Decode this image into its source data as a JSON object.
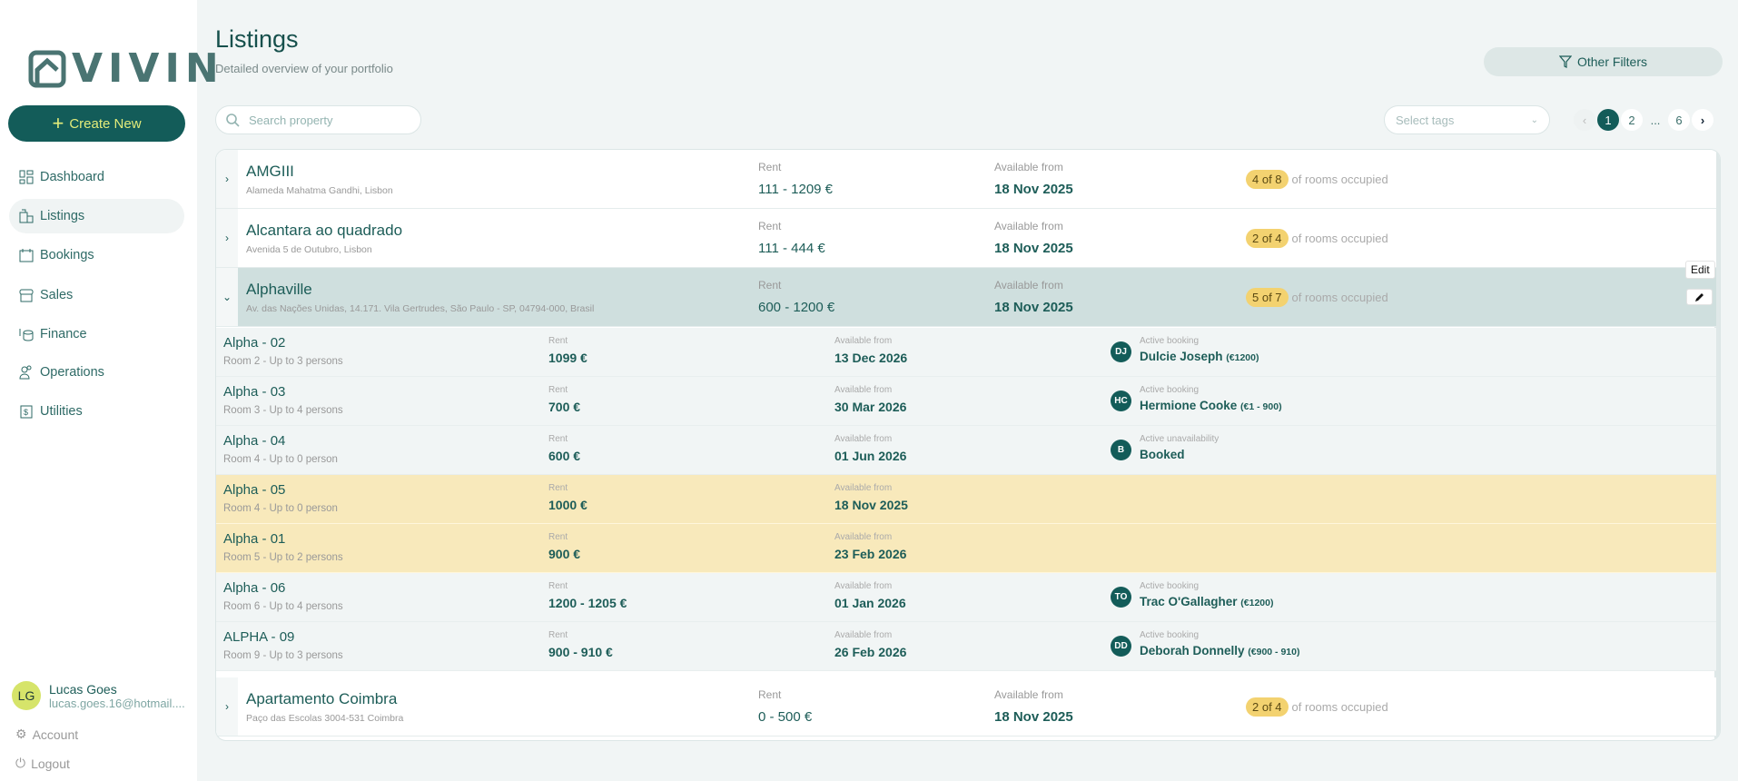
{
  "brand": {
    "name": "VIVIN"
  },
  "sidebar": {
    "create_label": "Create New",
    "items": [
      {
        "label": "Dashboard",
        "icon": "dashboard-icon"
      },
      {
        "label": "Listings",
        "icon": "building-icon",
        "active": true
      },
      {
        "label": "Bookings",
        "icon": "calendar-icon"
      },
      {
        "label": "Sales",
        "icon": "store-icon"
      },
      {
        "label": "Finance",
        "icon": "coins-icon"
      },
      {
        "label": "Operations",
        "icon": "users-icon"
      },
      {
        "label": "Utilities",
        "icon": "receipt-icon"
      }
    ],
    "user": {
      "initials": "LG",
      "name": "Lucas Goes",
      "email": "lucas.goes.16@hotmail...."
    },
    "account_label": "Account",
    "logout_label": "Logout"
  },
  "header": {
    "title": "Listings",
    "subtitle": "Detailed overview of your portfolio",
    "other_filters": "Other Filters"
  },
  "search": {
    "placeholder": "Search property",
    "value": ""
  },
  "tags": {
    "placeholder": "Select tags"
  },
  "pagination": {
    "pages": [
      "1",
      "2",
      "...",
      "6"
    ],
    "current": "1"
  },
  "labels": {
    "rent": "Rent",
    "available": "Available from",
    "occupied": "of rooms occupied",
    "edit": "Edit"
  },
  "properties": [
    {
      "name": "AMGIII",
      "address": "Alameda Mahatma Gandhi, Lisbon",
      "rent": "111 - 1209 €",
      "available": "18 Nov 2025",
      "occupancy": "4 of 8"
    },
    {
      "name": "Alcantara ao quadrado",
      "address": "Avenida 5 de Outubro, Lisbon",
      "rent": "111 - 444 €",
      "available": "18 Nov 2025",
      "occupancy": "2 of 4"
    },
    {
      "name": "Alphaville",
      "address": "Av. das Nações Unidas, 14.171. Vila Gertrudes, São Paulo - SP, 04794-000, Brasil",
      "rent": "600 - 1200 €",
      "available": "18 Nov 2025",
      "occupancy": "5 of 7"
    },
    {
      "name": "Apartamento Coimbra",
      "address": "Paço das Escolas 3004-531 Coimbra",
      "rent": "0 - 500 €",
      "available": "18 Nov 2025",
      "occupancy": "2 of 4"
    }
  ],
  "rooms": [
    {
      "name": "Alpha - 02",
      "desc": "Room 2 - Up to 3 persons",
      "rent": "1099 €",
      "available": "13 Dec 2026",
      "status_label": "Active booking",
      "initials": "DJ",
      "guest": "Dulcie Joseph",
      "amount": "(€1200)"
    },
    {
      "name": "Alpha - 03",
      "desc": "Room 3 - Up to 4 persons",
      "rent": "700 €",
      "available": "30 Mar 2026",
      "status_label": "Active booking",
      "initials": "HC",
      "guest": "Hermione Cooke",
      "amount": "(€1 - 900)"
    },
    {
      "name": "Alpha - 04",
      "desc": "Room 4 - Up to 0 person",
      "rent": "600 €",
      "available": "01 Jun 2026",
      "status_label": "Active unavailability",
      "initials": "B",
      "guest": "Booked",
      "amount": ""
    },
    {
      "name": "Alpha - 05",
      "desc": "Room 4 - Up to 0 person",
      "rent": "1000 €",
      "available": "18 Nov 2025",
      "highlight": true
    },
    {
      "name": "Alpha - 01",
      "desc": "Room 5 - Up to 2 persons",
      "rent": "900 €",
      "available": "23 Feb 2026",
      "highlight": true
    },
    {
      "name": "Alpha - 06",
      "desc": "Room 6 - Up to 4 persons",
      "rent": "1200 - 1205 €",
      "available": "01 Jan 2026",
      "status_label": "Active booking",
      "initials": "TO",
      "guest": "Trac O'Gallagher",
      "amount": "(€1200)"
    },
    {
      "name": "ALPHA - 09",
      "desc": "Room 9 - Up to 3 persons",
      "rent": "900 - 910 €",
      "available": "26 Feb 2026",
      "status_label": "Active booking",
      "initials": "DD",
      "guest": "Deborah Donnelly",
      "amount": "(€900 - 910)"
    }
  ],
  "colors": {
    "primary": "#135c59",
    "accent": "#e3ec7a",
    "badge": "#f3d270",
    "highlight_row": "#f8e9bb",
    "expanded_row": "#cfdfde"
  }
}
